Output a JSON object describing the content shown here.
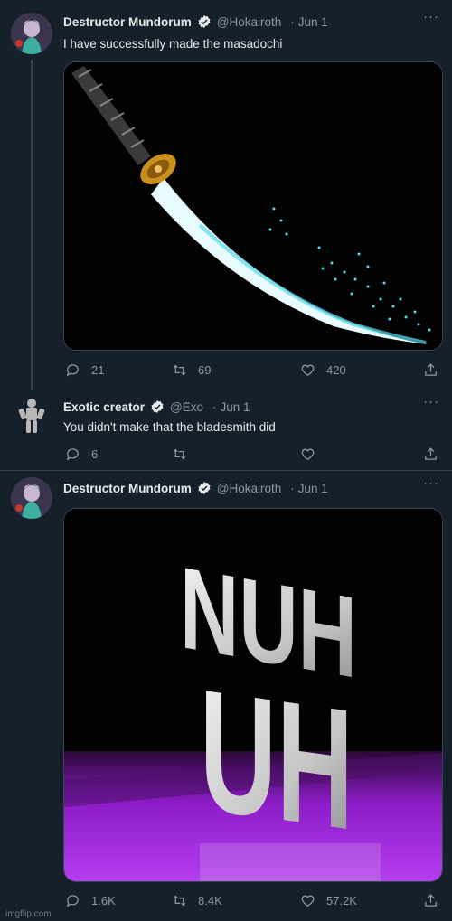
{
  "tweets": [
    {
      "name": "Destructor Mundorum",
      "handle": "@Hokairoth",
      "date": "Jun 1",
      "text": "I have successfully made the masadochi",
      "replies": "21",
      "retweets": "69",
      "likes": "420",
      "media": "katana-image"
    },
    {
      "name": "Exotic creator",
      "handle": "@Exo",
      "date": "Jun 1",
      "text": "You didn't make that the bladesmith did",
      "replies": "6",
      "retweets": "",
      "likes": ""
    },
    {
      "name": "Destructor Mundorum",
      "handle": "@Hokairoth",
      "date": "Jun 1",
      "text": "",
      "replies": "1.6K",
      "retweets": "8.4K",
      "likes": "57.2K",
      "media_text": [
        "NUH",
        "UH"
      ]
    }
  ],
  "ui": {
    "separator_dot": "·",
    "more_icon": "more-icon",
    "reply_icon": "reply-icon",
    "retweet_icon": "retweet-icon",
    "like_icon": "heart-icon",
    "share_icon": "share-icon",
    "verified_icon": "verified-badge-icon",
    "more_glyph": "···"
  },
  "watermark": "imgflip.com",
  "colors": {
    "background": "#15202b",
    "secondary_text": "#8b98a5",
    "border": "#38444d",
    "purple_floor": "#9b1fd3"
  }
}
